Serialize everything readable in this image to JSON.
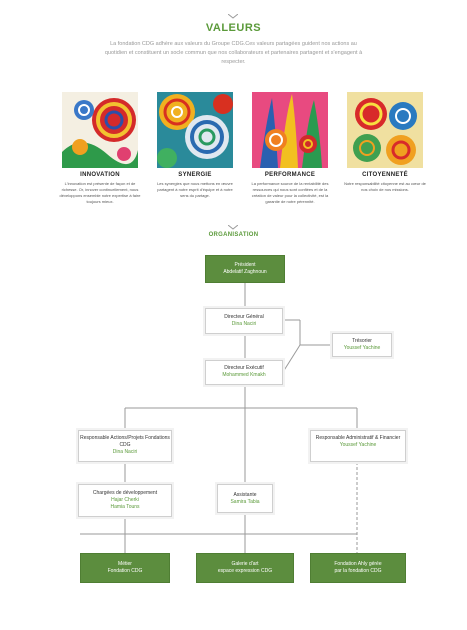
{
  "valeurs": {
    "title": "VALEURS",
    "text": "La fondation CDG adhère aux valeurs du Groupe CDG.Ces valeurs partagées guident nos actions au quotidien et constituent un socle commun que nos collaborateurs et partenaires partagent et s'engagent à respecter."
  },
  "cards": [
    {
      "label": "INNOVATION",
      "desc": "L'innovation est présente de façon et de richesse. Or, innover continuellement, nous développons ensemble notre expertise à faire toujours mieux."
    },
    {
      "label": "SYNERGIE",
      "desc": "Les synergies que nous mettons en œuvre partagent à notre esprit d'équipe et à notre sens du partage."
    },
    {
      "label": "PERFORMANCE",
      "desc": "La performance source de la rentabilité des ressources qui nous sont confiées et de la création de valeur pour la collectivité, est la garantie de notre pérennité."
    },
    {
      "label": "CITOYENNETÉ",
      "desc": "Notre responsabilité citoyenne est au cœur de nos choix de nos missions."
    }
  ],
  "organisation": {
    "title": "ORGANISATION",
    "president": {
      "role": "Président",
      "name": "Abdelatif Zaghnoun"
    },
    "dg": {
      "role": "Directeur Général",
      "name": "Dina Naciri"
    },
    "tresorier": {
      "role": "Trésorier",
      "name": "Youssef Yachine"
    },
    "de": {
      "role": "Directeur Exécutif",
      "name": "Mohammed Kmakh"
    },
    "rap": {
      "role": "Responsable Actions/Projets Fondations CDG",
      "name": "Dina Naciri"
    },
    "raf": {
      "role": "Responsable Administratif & Financier",
      "name": "Youssef Yachine"
    },
    "cdd": {
      "role": "Chargées de développement",
      "name1": "Hajar Cherki",
      "name2": "Hamia Touns"
    },
    "assist": {
      "role": "Assistante",
      "name": "Samira Tabia"
    },
    "metier": {
      "l1": "Métier",
      "l2": "Fondation CDG"
    },
    "galerie": {
      "l1": "Galerie d'art",
      "l2": "espace expression CDG"
    },
    "ahly": {
      "l1": "Fondation Ahly gérée",
      "l2": "par la fondation CDG"
    }
  },
  "colors": {
    "accent": "#5b9a3a",
    "box_green": "#5c8d3e"
  }
}
